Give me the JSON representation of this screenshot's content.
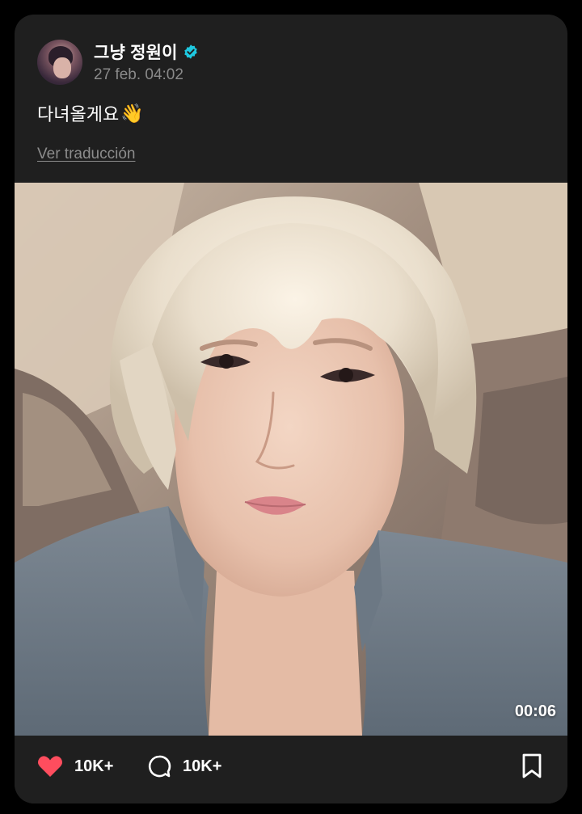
{
  "post": {
    "author_name": "그냥 정원이",
    "verified": true,
    "timestamp": "27 feb. 04:02",
    "text": "다녀올게요",
    "emoji": "👋",
    "translate_label": "Ver traducción"
  },
  "media": {
    "type": "video",
    "duration": "00:06"
  },
  "actions": {
    "likes": "10K+",
    "comments": "10K+"
  },
  "colors": {
    "card_background": "#1f1f1f",
    "page_background": "#000000",
    "verified_badge": "#1ec8e0",
    "like_heart": "#ff4d5e",
    "muted_text": "#8a8a8a"
  },
  "icons": {
    "verified": "verified-badge-icon",
    "like": "heart-icon",
    "comment": "comment-bubble-icon",
    "bookmark": "bookmark-icon"
  }
}
